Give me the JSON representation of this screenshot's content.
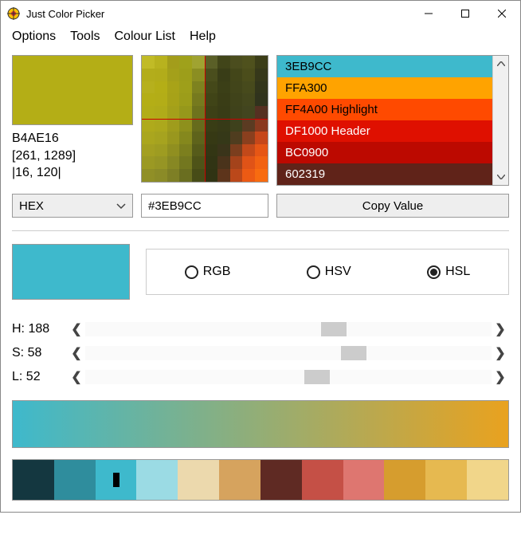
{
  "window": {
    "title": "Just Color Picker"
  },
  "menubar": [
    "Options",
    "Tools",
    "Colour List",
    "Help"
  ],
  "picked": {
    "swatch_color": "#b4ae16",
    "hex": "B4AE16",
    "coords": "[261, 1289]",
    "zoom": "|16, 120|"
  },
  "color_list": [
    {
      "label": "3EB9CC",
      "bg": "#3EB9CC",
      "fg": "#000"
    },
    {
      "label": "FFA300",
      "bg": "#FFA300",
      "fg": "#000"
    },
    {
      "label": "FF4A00 Highlight",
      "bg": "#FF4A00",
      "fg": "#000"
    },
    {
      "label": "DF1000 Header",
      "bg": "#DF1000",
      "fg": "#fff"
    },
    {
      "label": "BC0900",
      "bg": "#BC0900",
      "fg": "#fff"
    },
    {
      "label": "602319",
      "bg": "#602319",
      "fg": "#fff"
    }
  ],
  "format": {
    "selected": "HEX",
    "value": "#3EB9CC"
  },
  "copy_label": "Copy Value",
  "selected_swatch": "#3EB9CC",
  "color_modes": {
    "rgb": "RGB",
    "hsv": "HSV",
    "hsl": "HSL",
    "selected": "HSL"
  },
  "sliders": {
    "h": {
      "label": "H:",
      "value": "188",
      "pct": 58
    },
    "s": {
      "label": "S:",
      "value": "58",
      "pct": 63
    },
    "l": {
      "label": "L:",
      "value": "52",
      "pct": 54
    }
  },
  "gradient": {
    "from": "#3EB9CC",
    "to": "#E9A21F"
  },
  "palette": [
    "#143740",
    "#2f8d9d",
    "#3EB9CC",
    "#9bdbe4",
    "#ecd9ad",
    "#d6a35e",
    "#5f2a23",
    "#c55046",
    "#de7670",
    "#d69d2e",
    "#e6b950",
    "#f1d68a"
  ],
  "palette_selected_index": 2,
  "magnifier_pixels": [
    "#c1bb26",
    "#b8b21e",
    "#a39d1b",
    "#9fa11b",
    "#a0a331",
    "#5a5f27",
    "#414519",
    "#4b4d1e",
    "#4f511d",
    "#3c3e18",
    "#b3ad1b",
    "#b2ac1a",
    "#a4a01a",
    "#9d9e1a",
    "#8b8e22",
    "#4a4e1d",
    "#393d17",
    "#434619",
    "#4b4d1b",
    "#36381a",
    "#b6b01d",
    "#b4ae16",
    "#a8a318",
    "#9e9f1a",
    "#7e821f",
    "#444819",
    "#3b3f17",
    "#42451a",
    "#474a1c",
    "#32351b",
    "#b4ae16",
    "#b3ad17",
    "#a7a218",
    "#9c9d1a",
    "#767a1e",
    "#404417",
    "#3a3d16",
    "#40431a",
    "#44471d",
    "#30331d",
    "#b2ad18",
    "#b0ab19",
    "#a4a01a",
    "#96981b",
    "#6e731d",
    "#3d4016",
    "#393c16",
    "#3f421b",
    "#42451f",
    "#553022",
    "#afaa1b",
    "#aca81c",
    "#9f9c1c",
    "#8e901c",
    "#666b1c",
    "#393d15",
    "#373a17",
    "#3e411c",
    "#5b3b22",
    "#8a3a1f",
    "#aaa61e",
    "#a6a31f",
    "#99971e",
    "#85881d",
    "#5e631b",
    "#363914",
    "#353818",
    "#4f3d1f",
    "#8a3f1e",
    "#c6471a",
    "#a39f21",
    "#9e9c21",
    "#908f20",
    "#7c7f1e",
    "#565b1a",
    "#333614",
    "#3a341a",
    "#7b3e1e",
    "#c2491a",
    "#e65615",
    "#9b9923",
    "#969524",
    "#878823",
    "#73771f",
    "#4e5318",
    "#313414",
    "#4a331b",
    "#a4431b",
    "#e05317",
    "#f26212",
    "#908f26",
    "#8b8b27",
    "#7e7f25",
    "#6a6e20",
    "#474c17",
    "#303313",
    "#5d341b",
    "#bb481a",
    "#ec5a14",
    "#f86b10"
  ]
}
